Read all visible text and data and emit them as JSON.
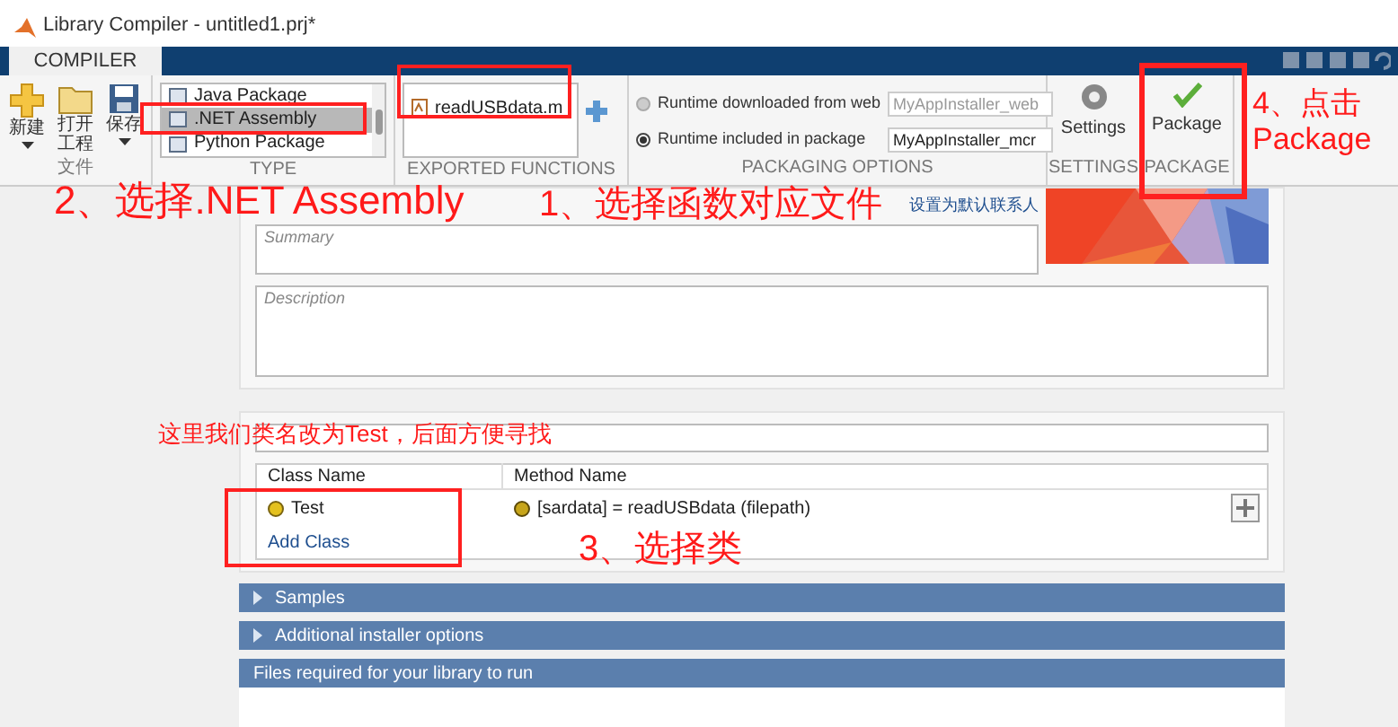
{
  "window": {
    "title": "Library Compiler - untitled1.prj*"
  },
  "ribbon_tabs": [
    {
      "label": "COMPILER",
      "selected": true
    }
  ],
  "file_section": {
    "label": "文件",
    "buttons": [
      {
        "label": "新建",
        "kind": "new",
        "dropdown": true
      },
      {
        "label": "打开工程",
        "kind": "open",
        "dropdown": false
      },
      {
        "label": "保存",
        "kind": "save",
        "dropdown": true
      }
    ]
  },
  "type_section": {
    "label": "TYPE",
    "items": [
      {
        "label": "Java Package",
        "selected": false
      },
      {
        "label": ".NET Assembly",
        "selected": true
      },
      {
        "label": "Python Package",
        "selected": false
      }
    ]
  },
  "exported_functions": {
    "label": "EXPORTED FUNCTIONS",
    "files": [
      "readUSBdata.m"
    ]
  },
  "packaging_options": {
    "label": "PACKAGING OPTIONS",
    "options": [
      {
        "label": "Runtime downloaded from web",
        "selected": false,
        "value": "MyAppInstaller_web",
        "disabled": true
      },
      {
        "label": "Runtime included in package",
        "selected": true,
        "value": "MyAppInstaller_mcr",
        "disabled": false
      }
    ]
  },
  "settings": {
    "label": "Settings",
    "section": "SETTINGS"
  },
  "package": {
    "label": "Package",
    "section": "PACKAGE"
  },
  "info": {
    "contact_link": "设置为默认联系人",
    "summary": {
      "placeholder": "Summary"
    },
    "description": {
      "placeholder": "Description"
    }
  },
  "classes": {
    "columns": [
      "Class Name",
      "Method Name"
    ],
    "rows": [
      {
        "class": "Test",
        "method": "[sardata] = readUSBdata (filepath)"
      }
    ],
    "add_link": "Add Class"
  },
  "sections": [
    {
      "label": "Samples",
      "kind": "collapsible",
      "expanded": false
    },
    {
      "label": "Additional installer options",
      "kind": "collapsible",
      "expanded": false
    },
    {
      "label": "Files required for your library to run",
      "kind": "header",
      "expanded": true
    }
  ],
  "annotations": [
    "2、选择.NET Assembly",
    "1、选择函数对应文件",
    "3、选择类",
    "4、点击Package",
    "这里我们类名改为Test，后面方便寻找"
  ]
}
